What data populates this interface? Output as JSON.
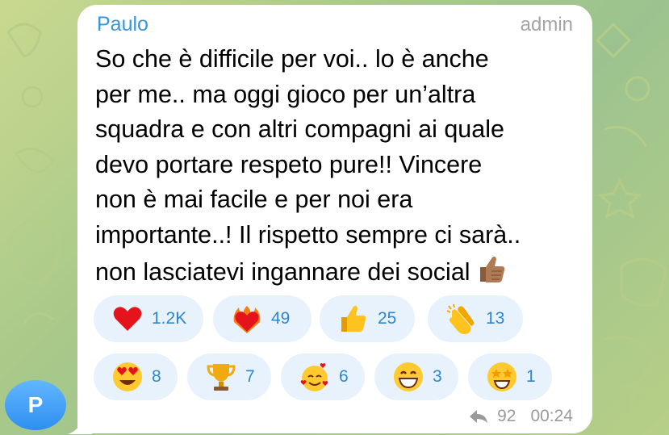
{
  "message": {
    "sender": "Paulo",
    "role": "admin",
    "lines": [
      "So che è difficile per voi.. lo è anche",
      "per me.. ma oggi gioco per un’altra",
      "squadra e con altri compagni ai quale",
      "devo portare respeto pure!! Vincere",
      "non è mai facile e per noi era",
      "importante..! Il rispetto sempre ci sarà..",
      "non lasciatevi ingannare dei social"
    ],
    "inline_emoji": "thumbs-up-medium-skin-icon",
    "forwards": "92",
    "time": "00:24"
  },
  "avatar": {
    "initial": "P",
    "color": "#3b9cf5"
  },
  "reactions": [
    {
      "icon": "red-heart-icon",
      "count": "1.2K"
    },
    {
      "icon": "heart-on-fire-icon",
      "count": "49"
    },
    {
      "icon": "thumbs-up-icon",
      "count": "25"
    },
    {
      "icon": "clapping-hands-icon",
      "count": "13"
    },
    {
      "icon": "heart-eyes-face-icon",
      "count": "8"
    },
    {
      "icon": "trophy-icon",
      "count": "7"
    },
    {
      "icon": "smiling-face-with-hearts-icon",
      "count": "6"
    },
    {
      "icon": "grinning-face-icon",
      "count": "3"
    },
    {
      "icon": "star-struck-face-icon",
      "count": "1"
    }
  ],
  "colors": {
    "sender_name": "#3a95d8",
    "reaction_bg": "#e7f2fc",
    "reaction_count": "#2f86cc",
    "meta_text": "#9a9a9a"
  }
}
